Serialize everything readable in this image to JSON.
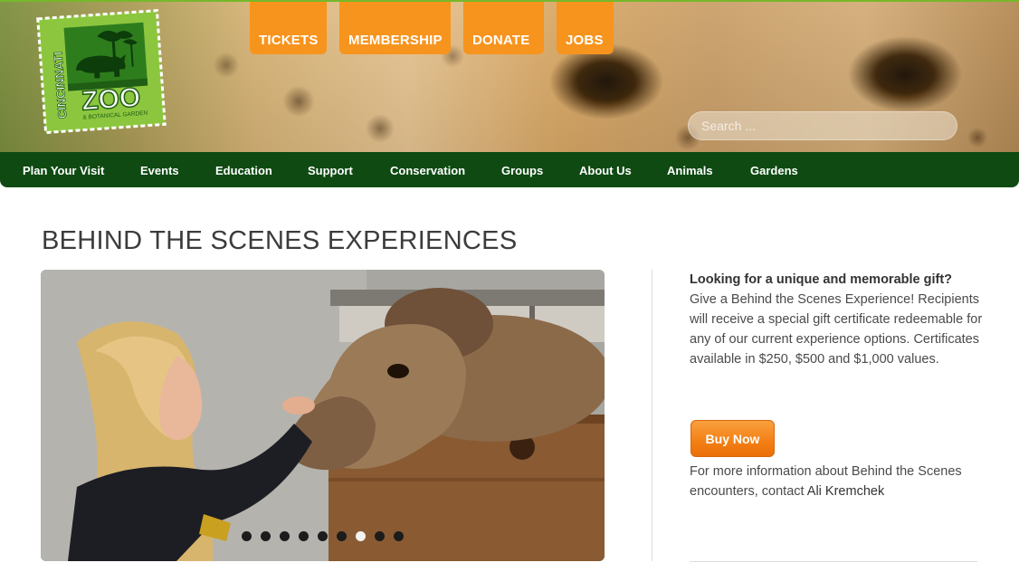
{
  "header": {
    "logo": {
      "line1": "CINCINNATI",
      "line2": "ZOO",
      "line3": "& BOTANICAL GARDEN"
    },
    "top_tabs": [
      {
        "label": "TICKETS"
      },
      {
        "label": "MEMBERSHIP"
      },
      {
        "label": "DONATE"
      },
      {
        "label": "JOBS"
      }
    ],
    "search": {
      "placeholder": "Search ..."
    }
  },
  "nav": {
    "items": [
      {
        "label": "Plan Your Visit"
      },
      {
        "label": "Events"
      },
      {
        "label": "Education"
      },
      {
        "label": "Support"
      },
      {
        "label": "Conservation"
      },
      {
        "label": "Groups"
      },
      {
        "label": "About Us"
      },
      {
        "label": "Animals"
      },
      {
        "label": "Gardens"
      }
    ]
  },
  "main": {
    "title": "BEHIND THE SCENES EXPERIENCES",
    "slider": {
      "slide_count": 9,
      "active_slide": 7
    },
    "sidebar": {
      "heading": "Looking for a unique and memorable gift?",
      "text": "Give a Behind the Scenes Experience! Recipients will receive a special gift certificate redeemable for any of our current experience options.  Certificates available in $250, $500 and $1,000 values.",
      "buy_label": "Buy Now",
      "more_info": "For more information about Behind the Scenes encounters, contact ",
      "contact_name": "Ali Kremchek"
    }
  },
  "colors": {
    "accent_orange": "#f7941d",
    "nav_green": "#0e4a12",
    "logo_green": "#76b82a"
  }
}
